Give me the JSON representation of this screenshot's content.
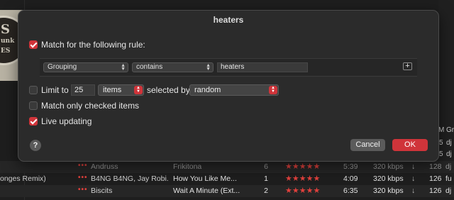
{
  "background": {
    "right_header": {
      "col1": "M",
      "col2": "Gr"
    },
    "right_rows": [
      {
        "a": "5",
        "b": "dj"
      },
      {
        "a": "5",
        "b": "dj"
      },
      {
        "a": "5",
        "b": "dj"
      }
    ],
    "rows": [
      {
        "lead": "",
        "artist": "Andruss",
        "title": "Frikitona",
        "num": "6",
        "stars": "★★★★★",
        "time": "5:39",
        "kbps": "320 kbps",
        "bpm": "128",
        "grp": "dj"
      },
      {
        "lead": "onges Remix)",
        "artist": "B4NG B4NG, Jay Robi...",
        "title": "How You Like Me...",
        "num": "1",
        "stars": "★★★★★",
        "time": "4:09",
        "kbps": "320 kbps",
        "bpm": "126",
        "grp": "fu"
      },
      {
        "lead": "",
        "artist": "Biscits",
        "title": "Wait A Minute (Ext...",
        "num": "2",
        "stars": "★★★★★",
        "time": "6:35",
        "kbps": "320 kbps",
        "bpm": "126",
        "grp": "dj"
      }
    ],
    "dots": "•••",
    "download_icon": "↓"
  },
  "dialog": {
    "title": "heaters",
    "match_rule_label": "Match for the following rule:",
    "rule": {
      "field": "Grouping",
      "operator": "contains",
      "value": "heaters"
    },
    "limit": {
      "label": "Limit to",
      "value": "25",
      "unit": "items",
      "selected_by_label": "selected by",
      "selected_by": "random"
    },
    "match_checked_label": "Match only checked items",
    "live_updating_label": "Live updating",
    "help": "?",
    "cancel_label": "Cancel",
    "ok_label": "OK",
    "checkbox_states": {
      "match_rule": true,
      "limit": false,
      "match_checked": false,
      "live_updating": true
    },
    "accent_color": "#d0343a"
  }
}
